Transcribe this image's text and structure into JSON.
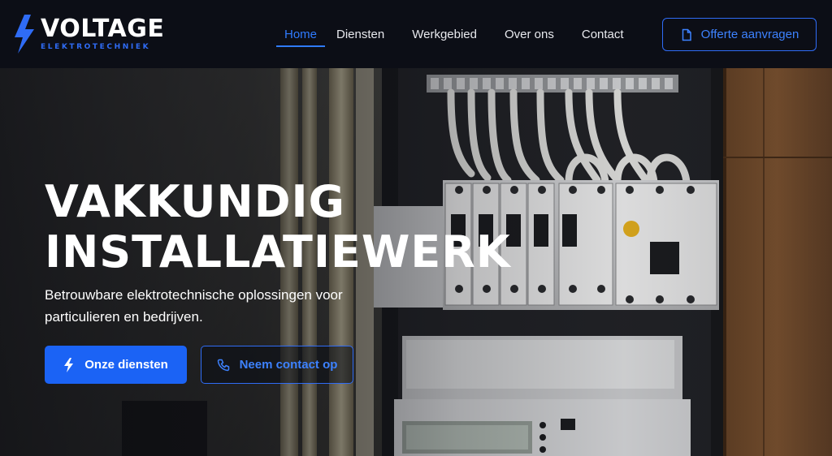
{
  "brand": {
    "name": "VOLTAGE",
    "tagline": "ELEKTROTECHNIEK",
    "accent_color": "#2f6cf6"
  },
  "nav": {
    "items": [
      {
        "label": "Home",
        "active": true
      },
      {
        "label": "Diensten",
        "active": false
      },
      {
        "label": "Werkgebied",
        "active": false
      },
      {
        "label": "Over ons",
        "active": false
      },
      {
        "label": "Contact",
        "active": false
      }
    ],
    "cta_label": "Offerte aanvragen",
    "cta_icon": "document-icon"
  },
  "hero": {
    "title_line1": "VAKKUNDIG",
    "title_line2": "INSTALLATIEWERK",
    "subtitle": "Betrouwbare elektrotechnische oplossingen voor particulieren en bedrijven.",
    "primary_button": {
      "label": "Onze diensten",
      "icon": "bolt-icon"
    },
    "secondary_button": {
      "label": "Neem contact op",
      "icon": "phone-icon"
    },
    "background_image": "electrical fuse box with circuit breakers and energy meter"
  }
}
